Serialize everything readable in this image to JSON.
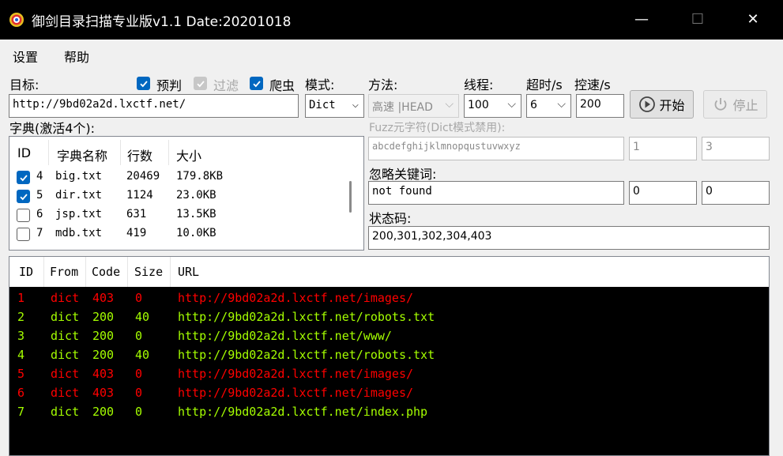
{
  "window": {
    "title": "御剑目录扫描专业版v1.1 Date:20201018",
    "minimize": "—",
    "maximize": "☐",
    "close": "✕"
  },
  "menu": {
    "items": [
      "设置",
      "帮助"
    ]
  },
  "form": {
    "target_label": "目标:",
    "target_value": "http://9bd02a2d.lxctf.net/",
    "options": {
      "prejudge_label": "预判",
      "prejudge_checked": true,
      "filter_label": "过滤",
      "filter_checked": true,
      "filter_disabled": true,
      "crawler_label": "爬虫",
      "crawler_checked": true
    },
    "mode_label": "模式:",
    "mode_value": "Dict",
    "method_label": "方法:",
    "method_value": "高速 |HEAD",
    "threads_label": "线程:",
    "threads_value": "100",
    "timeout_label": "超时/s",
    "timeout_value": "6",
    "speed_label": "控速/s",
    "speed_value": "200",
    "start_button": "开始",
    "stop_button": "停止",
    "dict_label": "字典(激活4个):",
    "fuzz_label": "Fuzz元字符(Dict模式禁用):",
    "fuzz_value": "abcdefghijklmnopqustuvwxyz",
    "fuzz_min": "1",
    "fuzz_max": "3",
    "ignore_label": "忽略关键词:",
    "ignore_value": "not found",
    "ignore_a": "0",
    "ignore_b": "0",
    "status_label": "状态码:",
    "status_value": "200,301,302,304,403"
  },
  "dict_table": {
    "headers": {
      "id": "ID",
      "name": "字典名称",
      "lines": "行数",
      "size": "大小"
    },
    "rows": [
      {
        "checked": true,
        "id": "4",
        "name": "big.txt",
        "lines": "20469",
        "size": "179.8KB"
      },
      {
        "checked": true,
        "id": "5",
        "name": "dir.txt",
        "lines": "1124",
        "size": "23.0KB"
      },
      {
        "checked": false,
        "id": "6",
        "name": "jsp.txt",
        "lines": "631",
        "size": "13.5KB"
      },
      {
        "checked": false,
        "id": "7",
        "name": "mdb.txt",
        "lines": "419",
        "size": "10.0KB"
      }
    ]
  },
  "results": {
    "headers": {
      "id": "ID",
      "from": "From",
      "code": "Code",
      "size": "Size",
      "url": "URL"
    },
    "rows": [
      {
        "id": "1",
        "from": "dict",
        "code": "403",
        "size": "0",
        "url": "http://9bd02a2d.lxctf.net/images/",
        "color": "#ff0000"
      },
      {
        "id": "2",
        "from": "dict",
        "code": "200",
        "size": "40",
        "url": "http://9bd02a2d.lxctf.net/robots.txt",
        "color": "#a5ff00"
      },
      {
        "id": "3",
        "from": "dict",
        "code": "200",
        "size": "0",
        "url": "http://9bd02a2d.lxctf.net/www/",
        "color": "#a5ff00"
      },
      {
        "id": "4",
        "from": "dict",
        "code": "200",
        "size": "40",
        "url": "http://9bd02a2d.lxctf.net/robots.txt",
        "color": "#a5ff00"
      },
      {
        "id": "5",
        "from": "dict",
        "code": "403",
        "size": "0",
        "url": "http://9bd02a2d.lxctf.net/images/",
        "color": "#ff0000"
      },
      {
        "id": "6",
        "from": "dict",
        "code": "403",
        "size": "0",
        "url": "http://9bd02a2d.lxctf.net/images/",
        "color": "#ff0000"
      },
      {
        "id": "7",
        "from": "dict",
        "code": "200",
        "size": "0",
        "url": "http://9bd02a2d.lxctf.net/index.php",
        "color": "#a5ff00"
      }
    ]
  }
}
